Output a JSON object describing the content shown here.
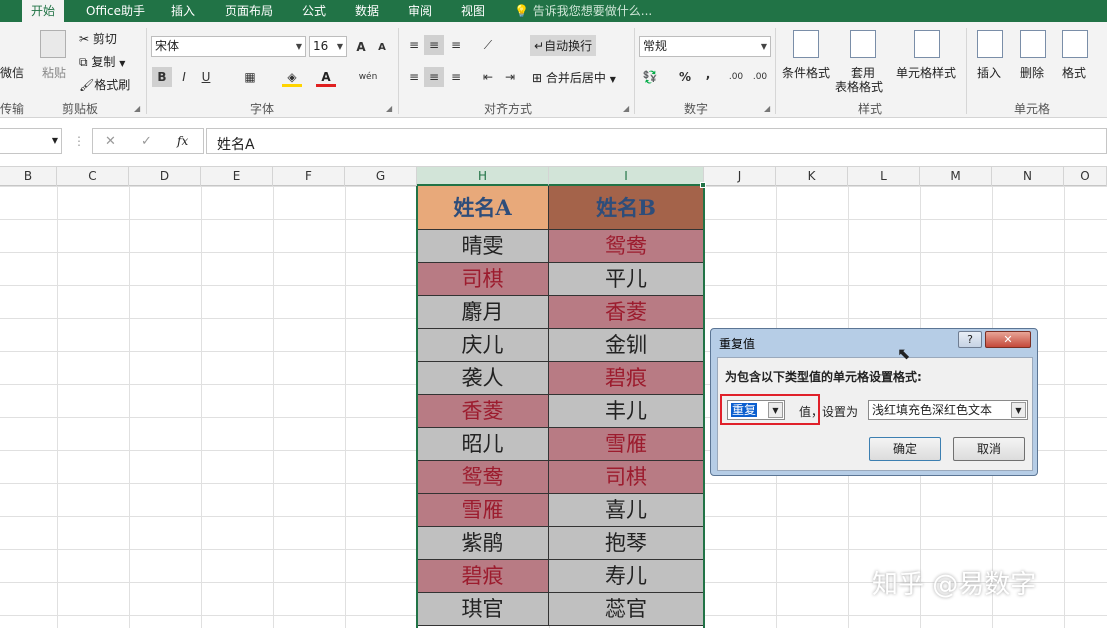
{
  "tabs": [
    "开始",
    "Office助手",
    "插入",
    "页面布局",
    "公式",
    "数据",
    "审阅",
    "视图"
  ],
  "tell_me": "告诉我您想要做什么...",
  "clipboard": {
    "wechat": "微信",
    "transfer": "传输",
    "paste": "粘贴",
    "cut": "剪切",
    "copy": "复制",
    "format_painter": "格式刷",
    "group": "剪贴板"
  },
  "font": {
    "name": "宋体",
    "size": "16",
    "grow": "A",
    "shrink": "A",
    "bold": "B",
    "italic": "I",
    "underline": "U",
    "phonetic": "wén",
    "group": "字体"
  },
  "alignment": {
    "wrap": "自动换行",
    "merge": "合并后居中",
    "group": "对齐方式"
  },
  "number": {
    "format": "常规",
    "currency": "💱",
    "percent": "%",
    "comma": ",",
    "inc_decimal": ".00",
    "dec_decimal": ".00",
    "group": "数字"
  },
  "styles": {
    "cond_format": "条件格式",
    "table_format_1": "套用",
    "table_format_2": "表格格式",
    "cell_styles": "单元格样式",
    "group": "样式"
  },
  "cells": {
    "insert": "插入",
    "delete": "删除",
    "format": "格式",
    "group": "单元格"
  },
  "formula_bar": {
    "cancel": "✕",
    "enter": "✓",
    "fx": "fx",
    "content": "姓名A"
  },
  "columns": [
    "B",
    "C",
    "D",
    "E",
    "F",
    "G",
    "H",
    "I",
    "J",
    "K",
    "L",
    "M",
    "N",
    "O"
  ],
  "table": {
    "header_a": "姓名A",
    "header_b": "姓名B",
    "rows": [
      [
        "晴雯",
        "鸳鸯"
      ],
      [
        "司棋",
        "平儿"
      ],
      [
        "麝月",
        "香菱"
      ],
      [
        "庆儿",
        "金钏"
      ],
      [
        "袭人",
        "碧痕"
      ],
      [
        "香菱",
        "丰儿"
      ],
      [
        "昭儿",
        "雪雁"
      ],
      [
        "鸳鸯",
        "司棋"
      ],
      [
        "雪雁",
        "喜儿"
      ],
      [
        "紫鹃",
        "抱琴"
      ],
      [
        "碧痕",
        "寿儿"
      ],
      [
        "琪官",
        "蕊官"
      ]
    ],
    "dup_a": [
      false,
      true,
      false,
      false,
      false,
      true,
      false,
      true,
      true,
      false,
      true,
      false
    ],
    "dup_b": [
      true,
      false,
      true,
      false,
      true,
      false,
      true,
      true,
      false,
      false,
      false,
      false
    ]
  },
  "colors": {
    "green": "#217346",
    "header_a": "#e8a97a",
    "header_b": "#a4634a",
    "dup_fill": "#b87b84",
    "dup_text": "#9c1c2e",
    "normal_fill": "#c0c0c0"
  },
  "dialog": {
    "title": "重复值",
    "help": "?",
    "close": "✕",
    "prompt": "为包含以下类型值的单元格设置格式:",
    "type_value": "重复",
    "value_label": "值，",
    "set_as_label": "设置为",
    "format_value": "浅红填充色深红色文本",
    "ok": "确定",
    "cancel": "取消"
  },
  "watermark": "知乎 @易数字"
}
